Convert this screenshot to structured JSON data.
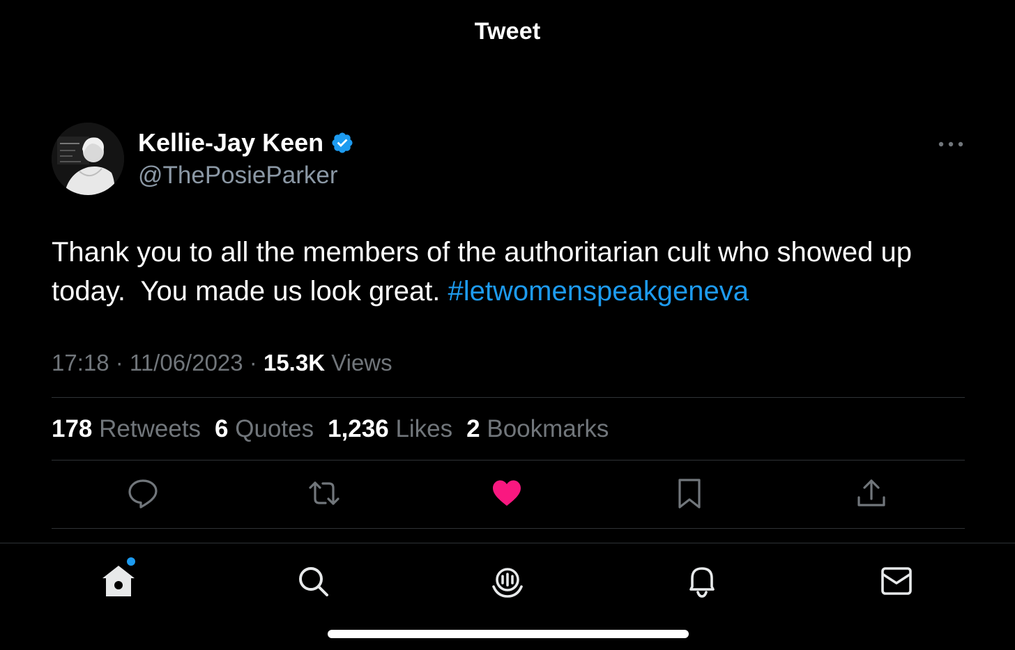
{
  "header": {
    "title": "Tweet"
  },
  "tweet": {
    "author": {
      "name": "Kellie-Jay Keen",
      "handle": "@ThePosieParker",
      "verified": true,
      "avatar_icon": "profile-photo"
    },
    "text": "Thank you to all the members of the authoritarian cult who showed up today.  You made us look great. ",
    "hashtag": "#letwomenspeakgeneva",
    "time": "17:18",
    "date": "11/06/2023",
    "views_count": "15.3K",
    "views_label": "Views",
    "stats": {
      "retweets_count": "178",
      "retweets_label": "Retweets",
      "quotes_count": "6",
      "quotes_label": "Quotes",
      "likes_count": "1,236",
      "likes_label": "Likes",
      "bookmarks_count": "2",
      "bookmarks_label": "Bookmarks"
    },
    "liked": true
  },
  "actions": [
    "reply-icon",
    "retweet-icon",
    "like-icon",
    "bookmark-icon",
    "share-icon"
  ],
  "tab_bar": [
    "home-icon",
    "search-icon",
    "spaces-icon",
    "notifications-icon",
    "messages-icon"
  ],
  "colors": {
    "background": "#000000",
    "accent": "#1d9bf0",
    "like": "#f91880",
    "muted": "#71767b",
    "divider": "#2f3336"
  }
}
